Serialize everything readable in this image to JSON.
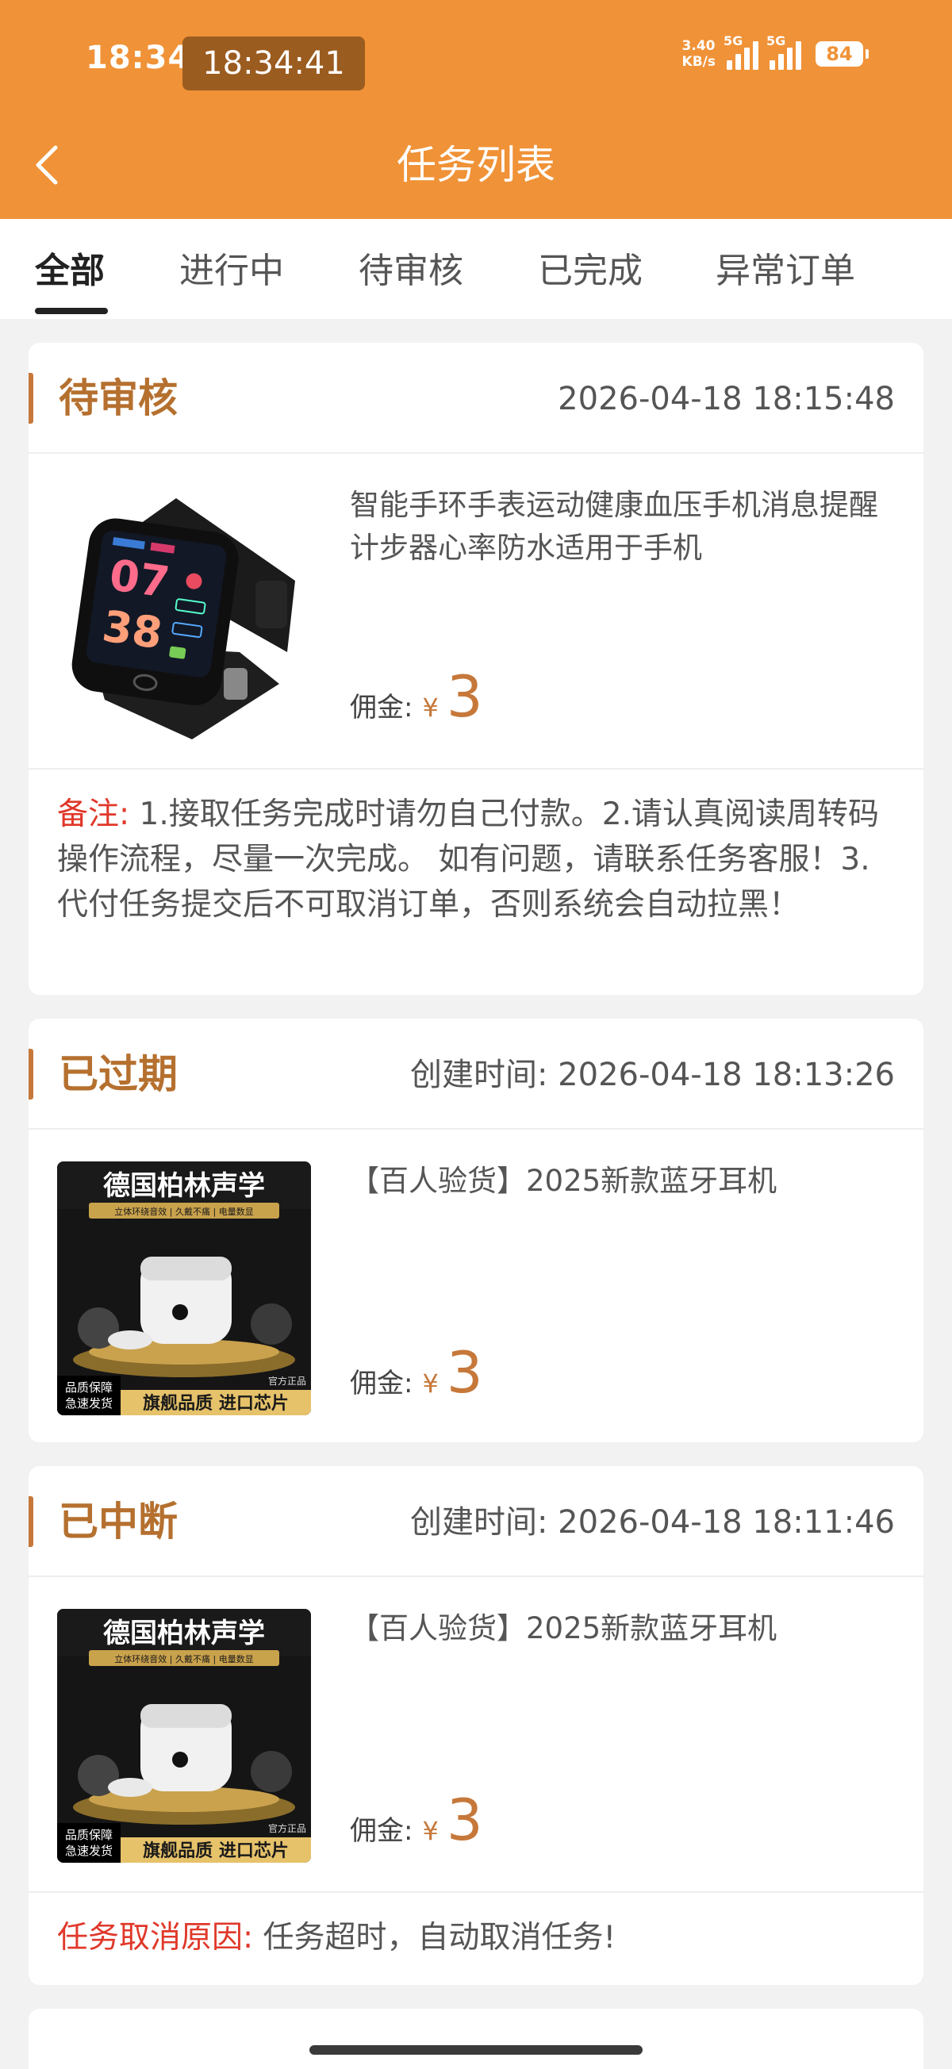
{
  "status_bar": {
    "time": "18:34",
    "clock_overlay": "18:34:41",
    "speed_value": "3.40",
    "speed_unit": "KB/s",
    "network_1": "5G",
    "network_2": "5G",
    "battery": "84"
  },
  "header": {
    "title": "任务列表",
    "back_icon": "chevron-left-icon"
  },
  "tabs": [
    {
      "label": "全部",
      "active": true
    },
    {
      "label": "进行中",
      "active": false
    },
    {
      "label": "待审核",
      "active": false
    },
    {
      "label": "已完成",
      "active": false
    },
    {
      "label": "异常订单",
      "active": false
    }
  ],
  "tasks": [
    {
      "status": "待审核",
      "time": "2026-04-18 18:15:48",
      "product_title": "智能手环手表运动健康血压手机消息提醒计步器心率防水适用于手机",
      "commission_label": "佣金:",
      "currency": "¥",
      "commission": "3",
      "watch_display": {
        "top": "07",
        "bottom": "38"
      },
      "note_label": "备注:",
      "note_text": "1.接取任务完成时请勿自己付款。2.请认真阅读周转码操作流程，尽量一次完成。 如有问题，请联系任务客服！3.代付任务提交后不可取消订单，否则系统会自动拉黑！"
    },
    {
      "status": "已过期",
      "time": "创建时间:  2026-04-18 18:13:26",
      "product_title": "【百人验货】2025新款蓝牙耳机",
      "commission_label": "佣金:",
      "currency": "¥",
      "commission": "3",
      "ad": {
        "headline": "德国柏林声学",
        "tagline": "立体环绕音效 | 久戴不痛 | 电量数显",
        "badge_1": "品质保障",
        "badge_2": "急速发货",
        "footer": "旗舰品质  进口芯片",
        "seal": "官方正品"
      }
    },
    {
      "status": "已中断",
      "time": "创建时间:  2026-04-18 18:11:46",
      "product_title": "【百人验货】2025新款蓝牙耳机",
      "commission_label": "佣金:",
      "currency": "¥",
      "commission": "3",
      "ad": {
        "headline": "德国柏林声学",
        "tagline": "立体环绕音效 | 久戴不痛 | 电量数显",
        "badge_1": "品质保障",
        "badge_2": "急速发货",
        "footer": "旗舰品质  进口芯片",
        "seal": "官方正品"
      },
      "cancel_label": "任务取消原因:",
      "cancel_text": "任务超时，自动取消任务!"
    }
  ]
}
